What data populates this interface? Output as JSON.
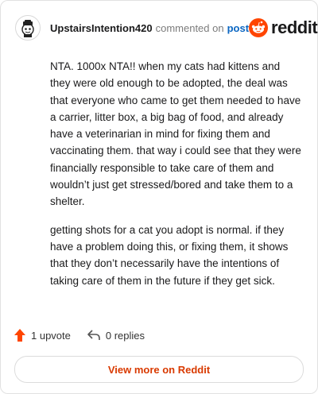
{
  "header": {
    "username": "UpstairsIntention420",
    "action_text": "commented on",
    "post_link": "post",
    "logo_text": "reddit",
    "icons": {
      "avatar": "snoo-avatar-icon",
      "logo": "reddit-snoo-icon"
    }
  },
  "comment": {
    "paragraphs": [
      "NTA. 1000x NTA!! when my cats had kittens and they were old enough to be adopted, the deal was that everyone who came to get them needed to have a carrier, litter box, a big bag of food, and already have a veterinarian in mind for fixing them and vaccinating them. that way i could see that they were financially responsible to take care of them and wouldn’t just get stressed/bored and take them to a shelter.",
      "getting shots for a cat you adopt is normal. if they have a problem doing this, or fixing them, it shows that they don’t necessarily have the intentions of taking care of them in the future if they get sick."
    ]
  },
  "footer": {
    "upvote_label": "1 upvote",
    "replies_label": "0 replies",
    "icons": {
      "upvote": "upvote-arrow-icon",
      "replies": "reply-arrow-icon"
    }
  },
  "cta": {
    "label": "View more on Reddit"
  },
  "colors": {
    "brand": "#ff4500",
    "link": "#0a66c2",
    "cta_text": "#d93a00",
    "text": "#1a1a1b",
    "muted": "#7c7c7c"
  }
}
